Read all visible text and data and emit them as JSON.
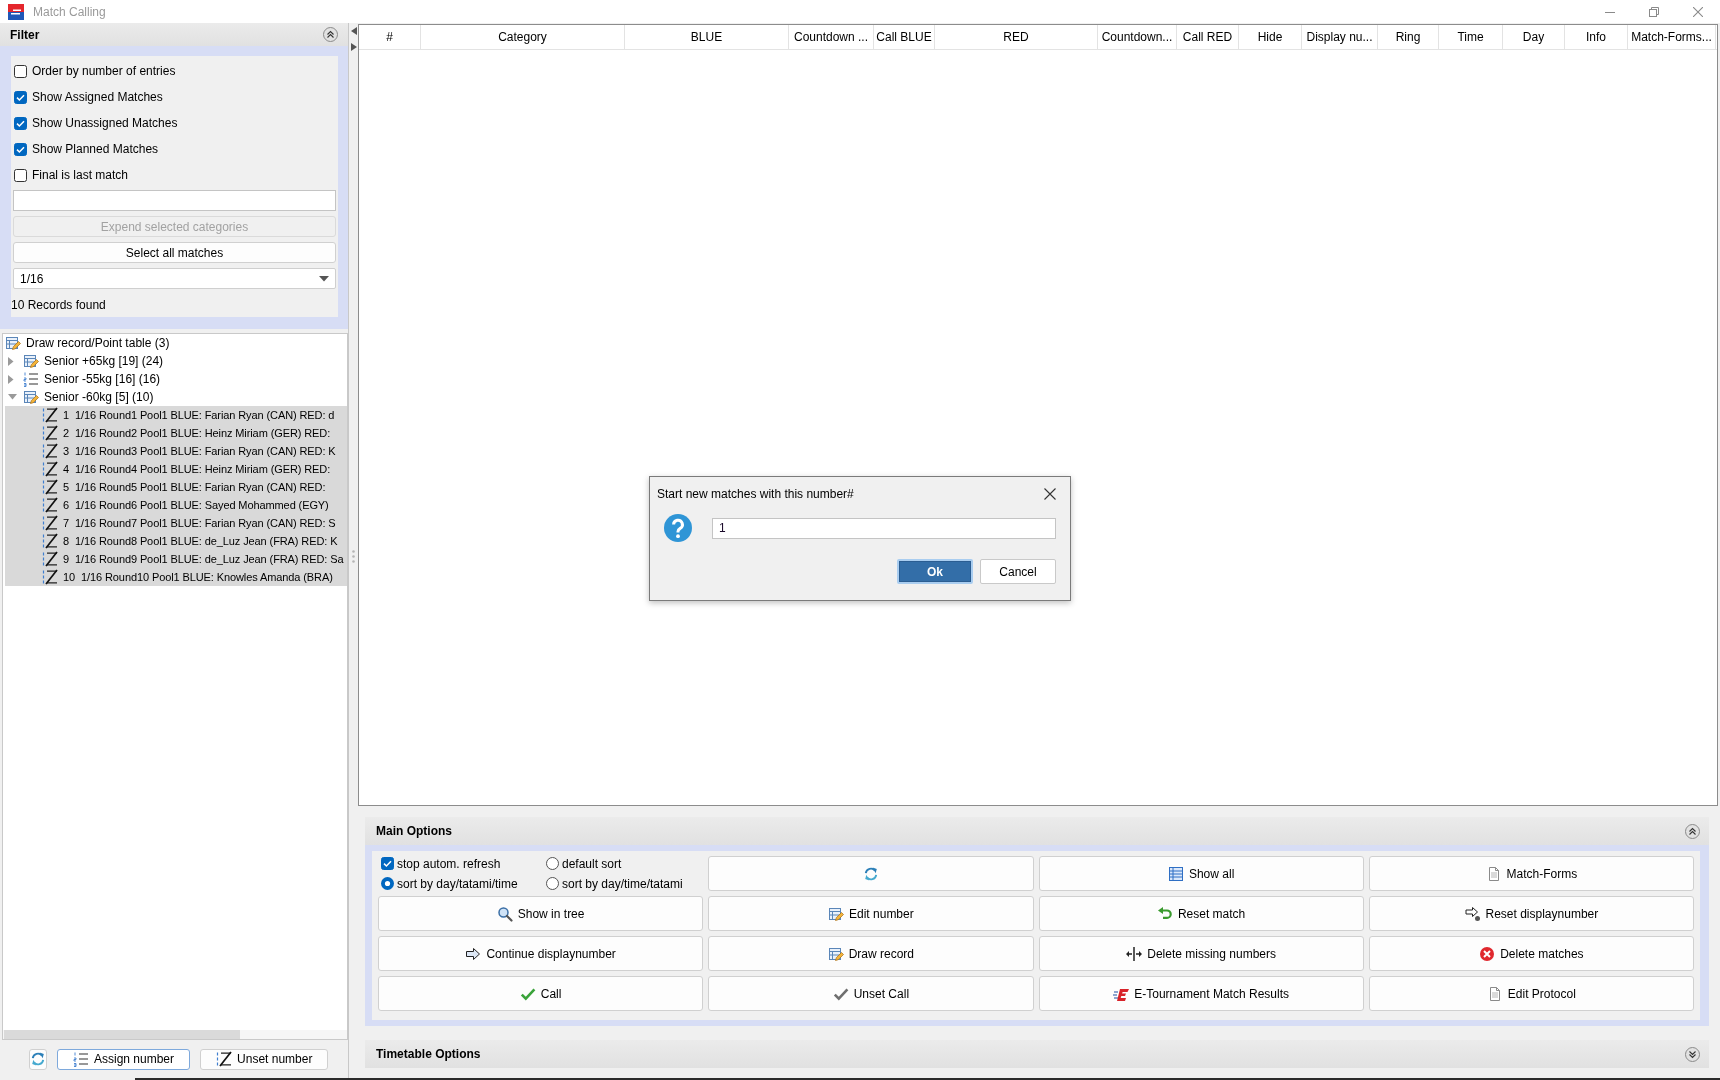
{
  "window": {
    "title": "Match Calling"
  },
  "filter": {
    "title": "Filter",
    "expanded": true,
    "options": [
      {
        "label": "Order by number of entries",
        "checked": false
      },
      {
        "label": "Show Assigned Matches",
        "checked": true
      },
      {
        "label": "Show Unassigned Matches",
        "checked": true
      },
      {
        "label": "Show Planned Matches",
        "checked": true
      },
      {
        "label": "Final is last match",
        "checked": false
      }
    ],
    "buttons": [
      {
        "label": "Expend selected categories",
        "disabled": true
      },
      {
        "label": "Select all matches",
        "disabled": false
      }
    ],
    "dropdown": {
      "value": "1/16"
    },
    "status": "10 Records found"
  },
  "tree": {
    "items": [
      {
        "kind": "table",
        "label": "Draw record/Point table (3)",
        "selected": false,
        "children": [
          {
            "kind": "table",
            "label": "Senior +65kg [19] (24)",
            "expanded": false,
            "selected": false
          },
          {
            "kind": "list",
            "label": "Senior -55kg [16] (16)",
            "expanded": false,
            "selected": false
          },
          {
            "kind": "table",
            "label": "Senior -60kg [5] (10)",
            "expanded": true,
            "selected": false,
            "children": [
              {
                "kind": "match",
                "number": "1",
                "label": "1/16 Round1 Pool1 BLUE: Farian Ryan (CAN) RED: d",
                "selected": true
              },
              {
                "kind": "match",
                "number": "2",
                "label": "1/16 Round2 Pool1 BLUE: Heinz Miriam (GER) RED:",
                "selected": true
              },
              {
                "kind": "match",
                "number": "3",
                "label": "1/16 Round3 Pool1 BLUE: Farian Ryan (CAN) RED: K",
                "selected": true
              },
              {
                "kind": "match",
                "number": "4",
                "label": "1/16 Round4 Pool1 BLUE: Heinz Miriam (GER) RED:",
                "selected": true
              },
              {
                "kind": "match",
                "number": "5",
                "label": "1/16 Round5 Pool1 BLUE: Farian Ryan (CAN) RED:",
                "selected": true
              },
              {
                "kind": "match",
                "number": "6",
                "label": "1/16 Round6 Pool1 BLUE: Sayed Mohammed (EGY)",
                "selected": true
              },
              {
                "kind": "match",
                "number": "7",
                "label": "1/16 Round7 Pool1 BLUE: Farian Ryan (CAN) RED: S",
                "selected": true
              },
              {
                "kind": "match",
                "number": "8",
                "label": "1/16 Round8 Pool1 BLUE: de_Luz Jean (FRA) RED: K",
                "selected": true
              },
              {
                "kind": "match",
                "number": "9",
                "label": "1/16 Round9 Pool1 BLUE: de_Luz Jean (FRA) RED: Sa",
                "selected": true
              },
              {
                "kind": "match",
                "number": "10",
                "label": "1/16 Round10 Pool1 BLUE: Knowles Amanda (BRA)",
                "selected": true
              }
            ]
          }
        ]
      }
    ]
  },
  "tree_toolbar": {
    "buttons": [
      {
        "kind": "refresh",
        "focused": false
      },
      {
        "kind": "assign_number",
        "label": "Assign number",
        "focused": true
      },
      {
        "kind": "unset_number",
        "label": "Unset number",
        "focused": false
      }
    ]
  },
  "table": {
    "columns": [
      "#",
      "Category",
      "BLUE",
      "Countdown ...",
      "Call BLUE",
      "RED",
      "Countdown...",
      "Call RED",
      "Hide",
      "Display nu...",
      "Ring",
      "Time",
      "Day",
      "Info",
      "Match-Forms..."
    ]
  },
  "main_options": {
    "title": "Main Options",
    "expanded": true,
    "controls": [
      {
        "kind": "checkbox",
        "label": "stop autom. refresh",
        "checked": true
      },
      {
        "kind": "radio",
        "label": "default sort",
        "selected": false
      },
      {
        "kind": "radio",
        "label": "sort by day/tatami/time",
        "selected": true
      },
      {
        "kind": "radio",
        "label": "sort by day/time/tatami",
        "selected": false
      }
    ],
    "buttons": [
      {
        "kind": "refresh"
      },
      {
        "kind": "show_all",
        "label": "Show all"
      },
      {
        "kind": "match_forms",
        "label": "Match-Forms"
      },
      {
        "kind": "show_in_tree",
        "label": "Show in tree"
      },
      {
        "kind": "edit_number",
        "label": "Edit number"
      },
      {
        "kind": "reset_match",
        "label": "Reset match"
      },
      {
        "kind": "reset_displaynumber",
        "label": "Reset displaynumber"
      },
      {
        "kind": "continue_displaynumber",
        "label": "Continue displaynumber"
      },
      {
        "kind": "draw_record",
        "label": "Draw record"
      },
      {
        "kind": "delete_missing",
        "label": "Delete missing numbers"
      },
      {
        "kind": "delete_matches",
        "label": "Delete matches"
      },
      {
        "kind": "call",
        "label": "Call"
      },
      {
        "kind": "unset_call",
        "label": "Unset Call"
      },
      {
        "kind": "e_tournament",
        "label": "E-Tournament Match Results"
      },
      {
        "kind": "edit_protocol",
        "label": "Edit Protocol"
      }
    ]
  },
  "timetable_options": {
    "title": "Timetable Options",
    "expanded": false
  },
  "dialog": {
    "title": "Start new matches with this number#",
    "value": "1",
    "buttons": [
      {
        "label": "Ok",
        "default": true
      },
      {
        "label": "Cancel",
        "default": false
      }
    ]
  }
}
